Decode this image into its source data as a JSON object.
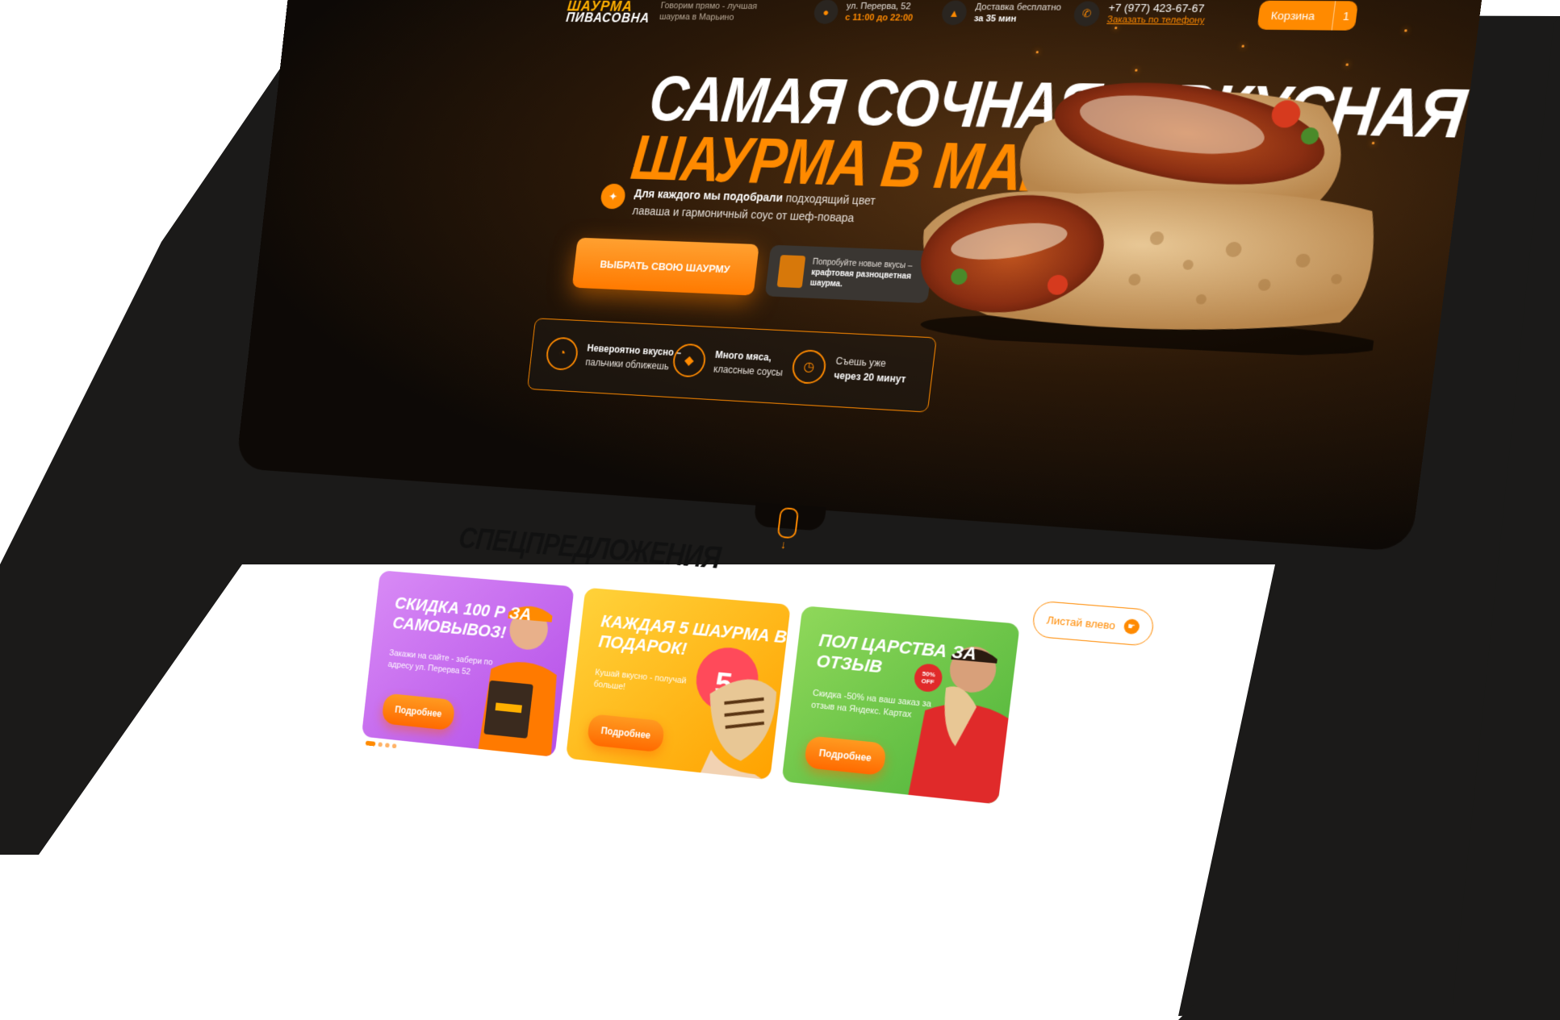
{
  "header": {
    "logo_top": "ШАУРМА",
    "logo_bottom": "ПИВАСОВНА",
    "tagline": "Говорим прямо - лучшая шаурма в Марьино",
    "address_line": "ул. Перерва, 52",
    "hours": "с 11:00 до 22:00",
    "delivery_line": "Доставка бесплатно",
    "delivery_time": "за 35 мин",
    "phone": "+7 (977) 423-67-67",
    "phone_link": "Заказать по телефону",
    "cart_label": "Корзина",
    "cart_count": "1"
  },
  "hero": {
    "title_line1": "САМАЯ СОЧНАЯ И ВКУСНАЯ",
    "title_line2": "ШАУРМА В МАРЬИНО",
    "subtitle_bold": "Для каждого мы подобрали",
    "subtitle_rest": " подходящий цвет лаваша и гармоничный соус от шеф-повара",
    "cta_label": "ВЫБРАТЬ СВОЮ ШАУРМУ",
    "try_text_1": "Попробуйте новые вкусы –",
    "try_text_bold": "крафтовая разноцветная шаурма.",
    "features": [
      {
        "bold": "Невероятно вкусно –",
        "rest": "пальчики оближешь"
      },
      {
        "bold": "Много мяса,",
        "rest": "классные соусы"
      },
      {
        "bold": "Съешь уже",
        "rest": "через 20 минут"
      }
    ]
  },
  "offers": {
    "heading": "СПЕЦПРЕДЛОЖЕНИЯ",
    "swipe_label": "Листай влево",
    "cards": [
      {
        "title": "СКИДКА 100 Р ЗА САМОВЫВОЗ!",
        "sub": "Закажи на сайте - забери по адресу ул. Перерва 52",
        "button": "Подробнее"
      },
      {
        "title": "КАЖДАЯ 5 ШАУРМА В ПОДАРОК!",
        "sub": "Кушай вкусно - получай больше!",
        "button": "Подробнее"
      },
      {
        "title": "ПОЛ ЦАРСТВА ЗА ОТЗЫВ",
        "sub": "Скидка -50% на ваш заказ за отзыв на Яндекс. Картах",
        "button": "Подробнее"
      }
    ],
    "badge": "50% OFF"
  },
  "colors": {
    "accent": "#ff8a00",
    "hero_bg": "#0d0906",
    "card1": "#c65cf0",
    "card2": "#ffb800",
    "card3": "#6cc84a"
  }
}
